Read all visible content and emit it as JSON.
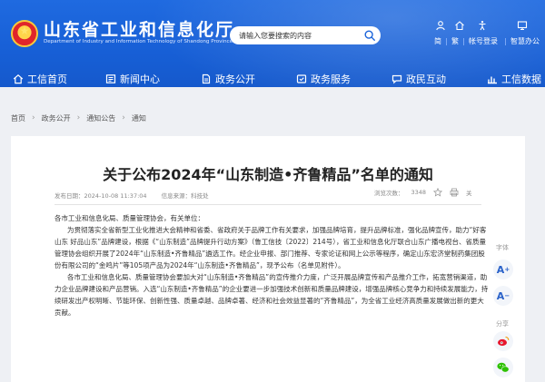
{
  "header": {
    "site_title": "山东省工业和信息化厅",
    "site_subtitle": "Department of Industry and Information Technology of Shandong Province",
    "search_placeholder": "请输入您要搜索的内容",
    "tools": [
      {
        "label": "简",
        "icon": "user-icon"
      },
      {
        "label": "繁",
        "icon": "home-icon"
      },
      {
        "label": "帐号登录",
        "icon": "accessibility-icon"
      },
      {
        "label": "智慧办公",
        "icon": "office-icon"
      }
    ]
  },
  "nav": {
    "items": [
      {
        "label": "工信首页",
        "icon": "home-icon"
      },
      {
        "label": "新闻中心",
        "icon": "news-icon"
      },
      {
        "label": "政务公开",
        "icon": "document-icon"
      },
      {
        "label": "政务服务",
        "icon": "service-icon"
      },
      {
        "label": "政民互动",
        "icon": "interaction-icon"
      },
      {
        "label": "工信数据",
        "icon": "data-icon"
      }
    ]
  },
  "breadcrumb": [
    "首页",
    "政务公开",
    "通知公告",
    "通知"
  ],
  "article": {
    "title": "关于公布2024年“山东制造•齐鲁精品”名单的通知",
    "publish_time": "发布日期：2024-10-08 11:37:04",
    "source": "信息来源：科技处",
    "views_label": "浏览次数：",
    "views": "3348",
    "close_label": "关",
    "salutation": "各市工业和信息化局、质量管理协会，有关单位：",
    "paragraphs": [
      "为贯彻落实全省新型工业化推进大会精神和省委、省政府关于品牌工作有关要求，加强品牌培育，提升品牌标准，强化品牌宣传，助力“好客山东 好品山东”品牌建设，根据《“山东制造”品牌提升行动方案》（鲁工信技〔2022〕214号），省工业和信息化厅联合山东广播电视台、省质量管理协会组织开展了2024年“山东制造•齐鲁精品”遴选工作。经企业申报、部门推荐、专家论证和网上公示等程序，确定山东宏济堂制药集团股份有限公司的“金鸣片”等105项产品为2024年“山东制造•齐鲁精品”，现予公布（名单见附件）。",
      "各市工业和信息化局、质量管理协会要加大对“山东制造•齐鲁精品”的宣传推介力度，广泛开展品牌宣传和产品推介工作，拓宽营销渠道，助力企业品牌建设和产品营销。入选“山东制造•齐鲁精品”的企业要进一步加强技术创新和质量品牌建设，增强品牌核心竞争力和持续发展能力，持续研发出产权明晰、节能环保、创新性强、质量卓越、品牌卓著、经济和社会效益显著的“齐鲁精品”，为全省工业经济高质量发展做出新的更大贡献。"
    ]
  },
  "side_tools": {
    "font_label": "字体",
    "font_increase": "A",
    "font_decrease": "A",
    "share_label": "分享"
  },
  "colors": {
    "header_blue": "#1a63da",
    "accent_blue": "#2a62c9",
    "weibo_red": "#e6162d",
    "wechat_green": "#2dc100"
  }
}
